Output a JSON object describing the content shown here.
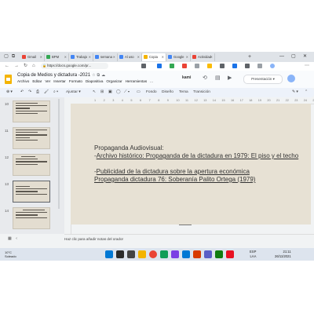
{
  "browser": {
    "tabs": [
      {
        "label": "Gmail",
        "color": "#ea4335"
      },
      {
        "label": "BPM",
        "color": "#34a853"
      },
      {
        "label": "Trabajo",
        "color": "#4285f4"
      },
      {
        "label": "semana",
        "color": "#4285f4"
      },
      {
        "label": "Al uso",
        "color": "#4285f4"
      },
      {
        "label": "Copia",
        "color": "#f4b400"
      },
      {
        "label": "Google",
        "color": "#4285f4"
      },
      {
        "label": "Actividad",
        "color": "#ea4335"
      }
    ],
    "url": "https://docs.google.com/pr..."
  },
  "doc": {
    "title": "Copia de Medios y dictadura -2021",
    "menus": [
      "Archivo",
      "Editar",
      "Ver",
      "Insertar",
      "Formato",
      "Diapositiva",
      "Organizar",
      "Herramientas",
      "..."
    ],
    "kami_label": "kami",
    "present_label": "Presentación"
  },
  "toolbar": {
    "adjust_label": "Ajustar",
    "items": [
      "Fondo",
      "Diseño",
      "Tema",
      "Transición"
    ]
  },
  "filmstrip": {
    "numbers": [
      "10",
      "11",
      "12",
      "13",
      "14"
    ]
  },
  "ruler_ticks": [
    "1",
    "2",
    "3",
    "4",
    "5",
    "6",
    "7",
    "8",
    "9",
    "10",
    "11",
    "12",
    "13",
    "14",
    "15",
    "16",
    "17",
    "18",
    "19",
    "20",
    "21",
    "22",
    "23",
    "24",
    "25"
  ],
  "slide": {
    "title": "Propaganda Audiovisual:",
    "prefix": "-",
    "link1": "Archivo histórico: Propaganda de la dictadura en 1979: El piso y el techo",
    "link2": "Publicidad de la dictadura sobre la apertura económica",
    "link3": "Propaganda dictadura 76: Soberanía Palito Ortega (1979)"
  },
  "notes": {
    "placeholder": "Haz clic para añadir notas del orador"
  },
  "taskbar": {
    "weather_temp": "10°C",
    "weather_desc": "Soleado",
    "lang": "ESP",
    "lang2": "LAA",
    "time": "21:11",
    "date": "26/11/2021"
  }
}
